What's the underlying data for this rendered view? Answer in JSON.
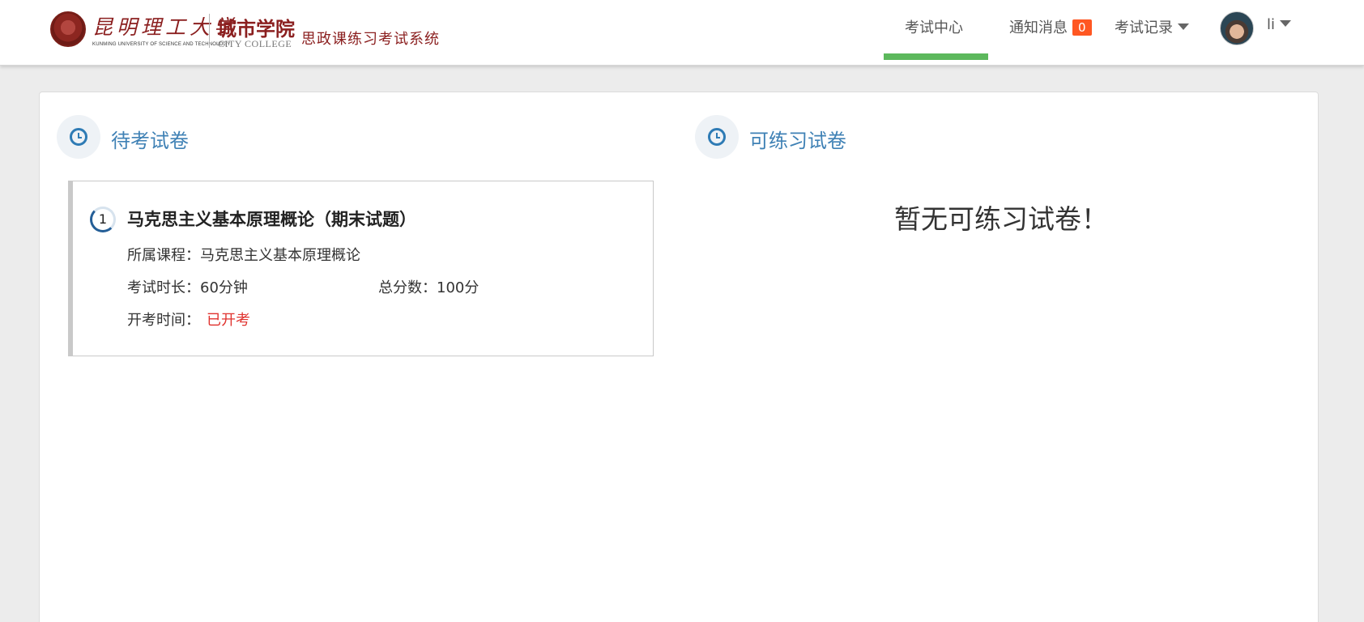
{
  "header": {
    "logo": {
      "university_cn": "昆明理工大学",
      "university_en": "KUNMING UNIVERSITY OF SCIENCE AND TECHNOLOGY",
      "college_cn": "城市学院",
      "college_en": "CITY COLLEGE",
      "system_name": "思政课练习考试系统"
    },
    "nav": {
      "exam_center": "考试中心",
      "notifications": "通知消息",
      "notifications_count": "0",
      "exam_records": "考试记录",
      "username": "li"
    }
  },
  "pending": {
    "title": "待考试卷",
    "exams": [
      {
        "index": "1",
        "name": "马克思主义基本原理概论（期末试题）",
        "course_label": "所属课程：",
        "course_value": "马克思主义基本原理概论",
        "duration_label": "考试时长：",
        "duration_value": "60分钟",
        "score_label": "总分数：",
        "score_value": "100分",
        "start_label": "开考时间：",
        "start_value": "已开考"
      }
    ]
  },
  "practice": {
    "title": "可练习试卷",
    "empty_message": "暂无可练习试卷！"
  },
  "colors": {
    "accent_blue": "#3f81b5",
    "active_tab_green": "#5cb85c",
    "badge_orange": "#ff5722",
    "status_red": "#e0322e",
    "brand_red": "#8b1f1f"
  }
}
